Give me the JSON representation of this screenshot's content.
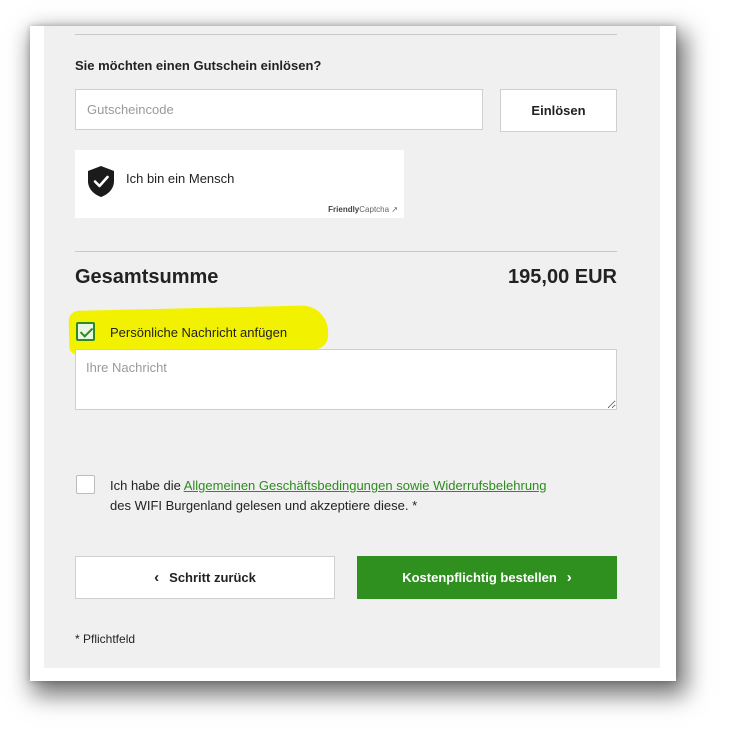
{
  "voucher": {
    "label": "Sie möchten einen Gutschein einlösen?",
    "placeholder": "Gutscheincode",
    "value": "",
    "redeem_label": "Einlösen"
  },
  "captcha": {
    "text": "Ich bin ein Mensch",
    "brand_bold": "Friendly",
    "brand_rest": "Captcha",
    "icon": "shield-check-icon"
  },
  "total": {
    "label": "Gesamtsumme",
    "amount": "195,00 EUR"
  },
  "message": {
    "checkbox_label": "Persönliche Nachricht anfügen",
    "checked": true,
    "placeholder": "Ihre Nachricht",
    "value": ""
  },
  "terms": {
    "prefix": "Ich habe die ",
    "link": "Allgemeinen Geschäftsbedingungen sowie Widerrufsbelehrung",
    "suffix": " des WIFI Burgenland gelesen und akzeptiere diese.  *",
    "checked": false
  },
  "buttons": {
    "back_label": "Schritt zurück",
    "order_label": "Kostenpflichtig bestellen"
  },
  "footer": {
    "required_note": "* Pflichtfeld"
  },
  "colors": {
    "accent_green": "#2f8f1f",
    "highlight_yellow": "#f2f200",
    "panel_bg": "#f0f0f0"
  }
}
